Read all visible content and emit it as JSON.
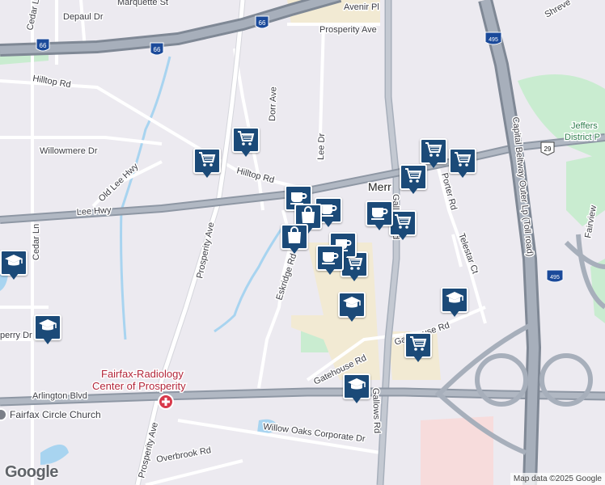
{
  "map": {
    "roads": {
      "i66_shield": "66",
      "i66_shield_2": "66",
      "i495_shield": "495",
      "i495_shield_2": "495",
      "us29_shield": "29",
      "prosperity_ave_top": "Prosperity Ave",
      "avenir": "Avenir Pl",
      "marquette": "Marquette St",
      "depaul": "Depaul Dr",
      "cedar_top": "Cedar Ln",
      "cedar": "Cedar Ln",
      "hilltop_left": "Hilltop Rd",
      "hilltop_mid": "Hilltop Rd",
      "dorr": "Dorr Ave",
      "willowmere": "Willowmere Dr",
      "old_lee_hwy": "Old Lee Hwy",
      "lee_hwy": "Lee Hwy",
      "prosperity_ave": "Prosperity Ave",
      "prosperity_ave_bottom": "Prosperity Ave",
      "eskridge": "Eskridge Rd",
      "lee_dr": "Lee Dr",
      "gallows": "Gallows Rd",
      "gallows_top": "Gallows Rd",
      "porter": "Porter Rd",
      "telestar": "Telestar Ct",
      "gatehouse": "Gatehouse Rd",
      "gatehouse_right": "Gatehouse Rd",
      "arlington": "Arlington Blvd",
      "willow_oaks": "Willow Oaks Corporate Dr",
      "overbrook": "Overbrook Rd",
      "capital_beltway": "Capital Beltway Outer Lp (Toll road)",
      "fairview": "Fairview",
      "shreve": "Shreve",
      "perry": "perry Dr"
    },
    "places": {
      "radiology_line1": "Fairfax-Radiology",
      "radiology_line2": "Center of Prosperity",
      "church": "Fairfax Circle Church",
      "jefferson_line1": "Jeffers",
      "jefferson_line2": "District P",
      "merrifield": "Merr"
    },
    "pins": [
      {
        "icon": "cart-icon"
      },
      {
        "icon": "cart-icon"
      },
      {
        "icon": "cart-icon"
      },
      {
        "icon": "cart-icon"
      },
      {
        "icon": "cart-icon"
      },
      {
        "icon": "cart-icon"
      },
      {
        "icon": "cart-icon"
      },
      {
        "icon": "cart-icon"
      },
      {
        "icon": "coffee-icon"
      },
      {
        "icon": "coffee-icon"
      },
      {
        "icon": "coffee-icon"
      },
      {
        "icon": "coffee-icon"
      },
      {
        "icon": "coffee-icon"
      },
      {
        "icon": "bag-icon"
      },
      {
        "icon": "bag-icon"
      },
      {
        "icon": "school-icon"
      },
      {
        "icon": "school-icon"
      },
      {
        "icon": "school-icon"
      },
      {
        "icon": "school-icon"
      },
      {
        "icon": "school-icon"
      }
    ],
    "logo": "Google",
    "attribution": "Map data ©2025 Google",
    "colors": {
      "pin": "#1b4a78",
      "highway": "#8e97a4",
      "road": "#ffffff",
      "park": "#c9ecd0",
      "water": "#a8d4f0",
      "commercial": "#f2ead3",
      "hospital": "#f7dcdc"
    }
  }
}
